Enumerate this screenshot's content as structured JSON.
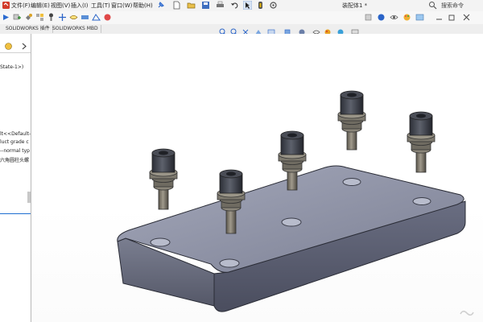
{
  "menu": {
    "file": "文件(F)",
    "edit": "编辑(E)",
    "view": "视图(V)",
    "insert": "插入(I)",
    "tools": "工具(T)",
    "window": "窗口(W)",
    "help": "帮助(H)"
  },
  "title": "装配体1 *",
  "search": {
    "placeholder": "搜索命令"
  },
  "tabs": [
    {
      "label": "SOLIDWORKS 插件"
    },
    {
      "label": "SOLIDWORKS MBD"
    }
  ],
  "tree": {
    "state": "State-1>)",
    "lines": [
      "lt<<Default-",
      "luct grade c",
      "--normal typ",
      "六角圆柱头螺"
    ]
  },
  "colors": {
    "plate_top": "#8e92a6",
    "plate_side": "#5b5f72",
    "bolt_metal": "#3a3d46",
    "bolt_shank": "#8a8579",
    "accent": "#1f6fd1"
  },
  "icons": [
    "logo-icon",
    "arrow-icon",
    "new-doc-icon",
    "open-icon",
    "save-icon",
    "print-icon",
    "undo-icon",
    "select-icon",
    "rebuild-icon",
    "options-icon",
    "pin-icon"
  ]
}
